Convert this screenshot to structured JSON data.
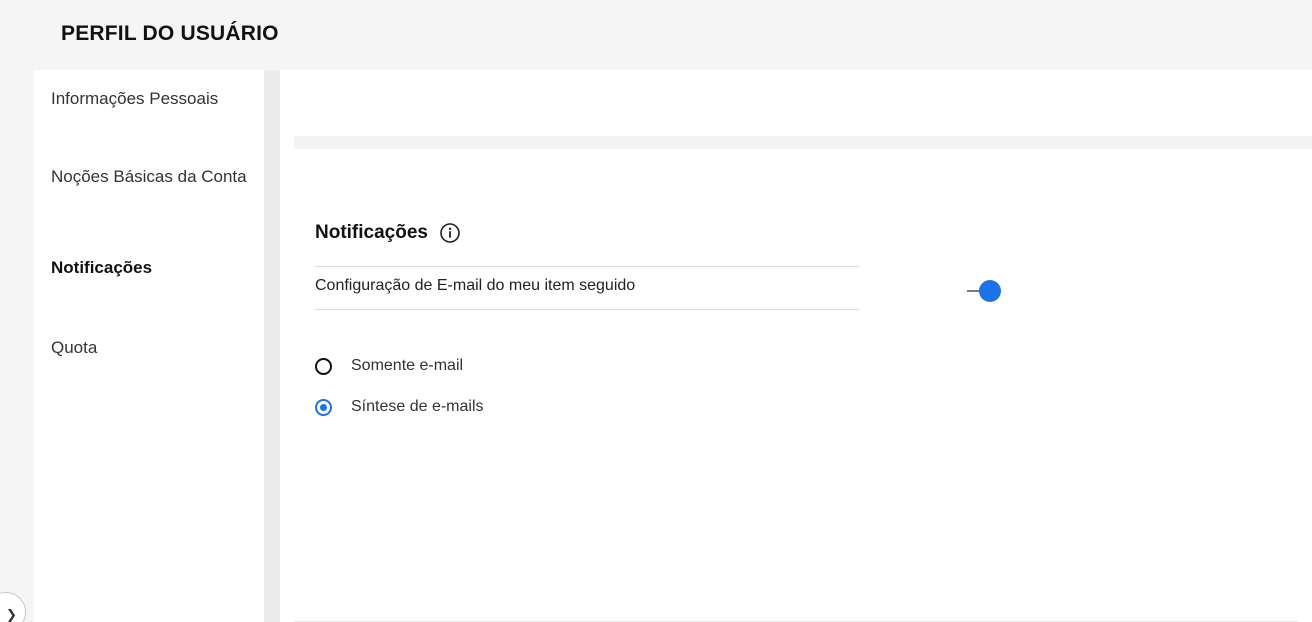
{
  "header": {
    "title": "PERFIL DO USUÁRIO"
  },
  "sidebar": {
    "items": [
      {
        "label": "Informações Pessoais",
        "active": false
      },
      {
        "label": "Noções Básicas da Conta",
        "active": false
      },
      {
        "label": "Notificações",
        "active": true
      },
      {
        "label": "Quota",
        "active": false
      }
    ],
    "collapse_icon": "chevron-right-icon"
  },
  "main": {
    "section_title": "Notificações",
    "info_icon": "info-icon",
    "setting": {
      "label": "Configuração de E-mail do meu item seguido",
      "enabled": true
    },
    "options": [
      {
        "label": "Somente e-mail",
        "selected": false
      },
      {
        "label": "Síntese de e-mails",
        "selected": true
      }
    ]
  },
  "colors": {
    "accent": "#1a73e8",
    "background": "#f5f5f5",
    "panel": "#ffffff"
  }
}
